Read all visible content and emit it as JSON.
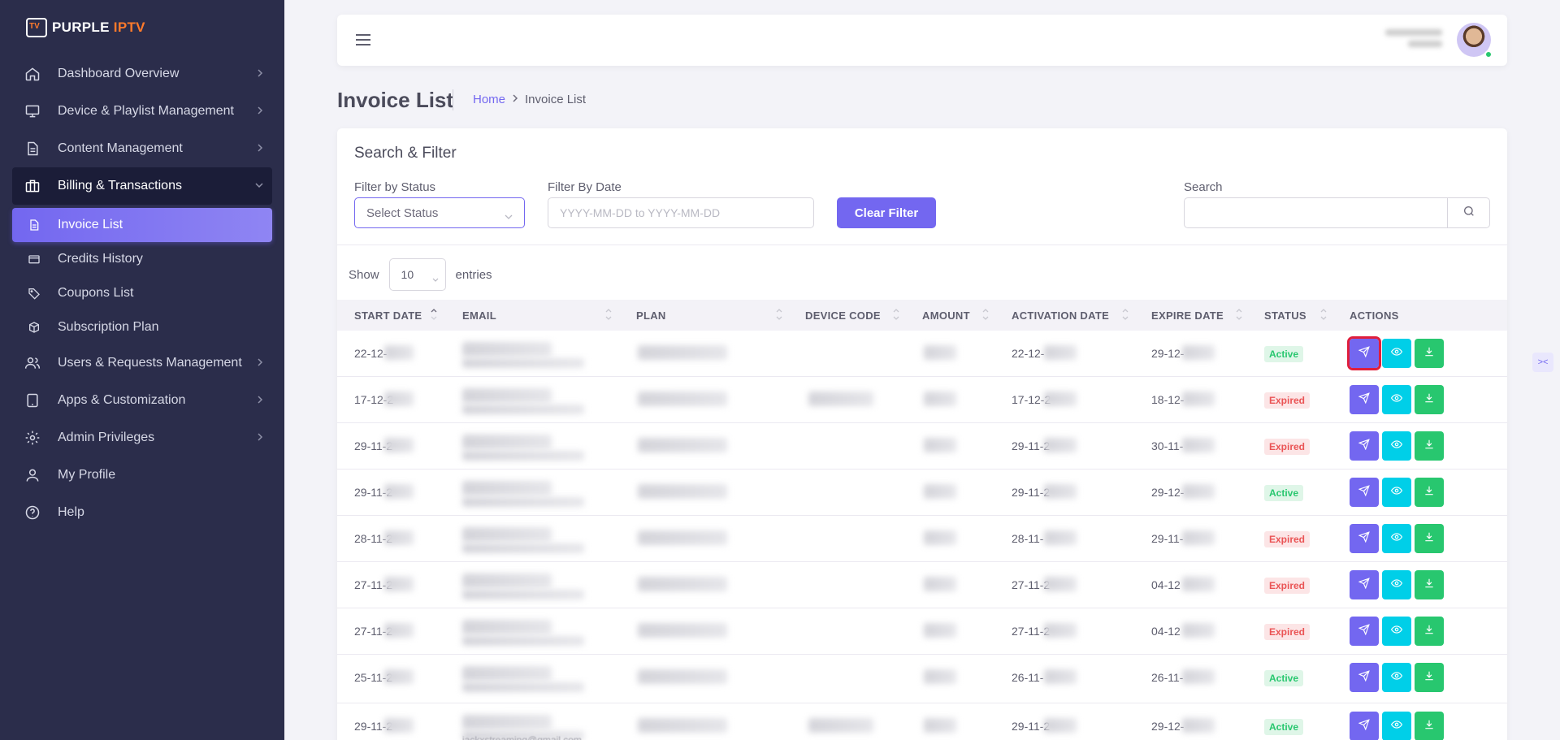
{
  "brand": {
    "name_part1": "PURPLE",
    "name_part2": "IPTV"
  },
  "sidebar": {
    "items": [
      {
        "label": "Dashboard Overview",
        "icon": "home-icon"
      },
      {
        "label": "Device & Playlist Management",
        "icon": "monitor-icon"
      },
      {
        "label": "Content Management",
        "icon": "document-icon"
      },
      {
        "label": "Billing & Transactions",
        "icon": "briefcase-icon"
      },
      {
        "label": "Users & Requests Management",
        "icon": "users-icon"
      },
      {
        "label": "Apps & Customization",
        "icon": "tablet-icon"
      },
      {
        "label": "Admin Privileges",
        "icon": "gear-icon"
      },
      {
        "label": "My Profile",
        "icon": "user-icon"
      },
      {
        "label": "Help",
        "icon": "help-icon"
      }
    ],
    "billing_sub": [
      {
        "label": "Invoice List",
        "icon": "file-icon"
      },
      {
        "label": "Credits History",
        "icon": "card-icon"
      },
      {
        "label": "Coupons List",
        "icon": "tag-icon"
      },
      {
        "label": "Subscription Plan",
        "icon": "box-icon"
      }
    ]
  },
  "page": {
    "title": "Invoice List",
    "breadcrumb_home": "Home",
    "breadcrumb_current": "Invoice List"
  },
  "filters": {
    "title": "Search & Filter",
    "status_label": "Filter by Status",
    "status_value": "Select Status",
    "date_label": "Filter By Date",
    "date_placeholder": "YYYY-MM-DD to YYYY-MM-DD",
    "clear_label": "Clear Filter",
    "search_label": "Search",
    "search_value": ""
  },
  "table": {
    "show_label": "Show",
    "page_size": "10",
    "entries_label": "entries",
    "columns": [
      "START DATE",
      "EMAIL",
      "PLAN",
      "DEVICE CODE",
      "AMOUNT",
      "ACTIVATION DATE",
      "EXPIRE DATE",
      "STATUS",
      "ACTIONS"
    ],
    "rows": [
      {
        "start": "22-12-",
        "activation": "22-12-",
        "expire": "29-12-",
        "status": "Active"
      },
      {
        "start": "17-12-2",
        "activation": "17-12-2",
        "expire": "18-12-",
        "status": "Expired"
      },
      {
        "start": "29-11-2",
        "activation": "29-11-2",
        "expire": "30-11-",
        "status": "Expired"
      },
      {
        "start": "29-11-2",
        "activation": "29-11-2",
        "expire": "29-12-",
        "status": "Active"
      },
      {
        "start": "28-11-2",
        "activation": "28-11-",
        "expire": "29-11-",
        "status": "Expired"
      },
      {
        "start": "27-11-2",
        "activation": "27-11-2",
        "expire": "04-12",
        "status": "Expired"
      },
      {
        "start": "27-11-2",
        "activation": "27-11-2",
        "expire": "04-12",
        "status": "Expired"
      },
      {
        "start": "25-11-2",
        "activation": "26-11-",
        "expire": "26-11-",
        "status": "Active"
      },
      {
        "start": "29-11-2",
        "activation": "29-11-2",
        "expire": "29-12-",
        "status": "Active",
        "email_visible": "jackxstreaming@gmail.com"
      }
    ]
  },
  "colors": {
    "primary": "#7367f0",
    "info": "#00cfe8",
    "success": "#28c76f",
    "danger": "#ea5455",
    "sidebar": "#2b2d4b"
  }
}
